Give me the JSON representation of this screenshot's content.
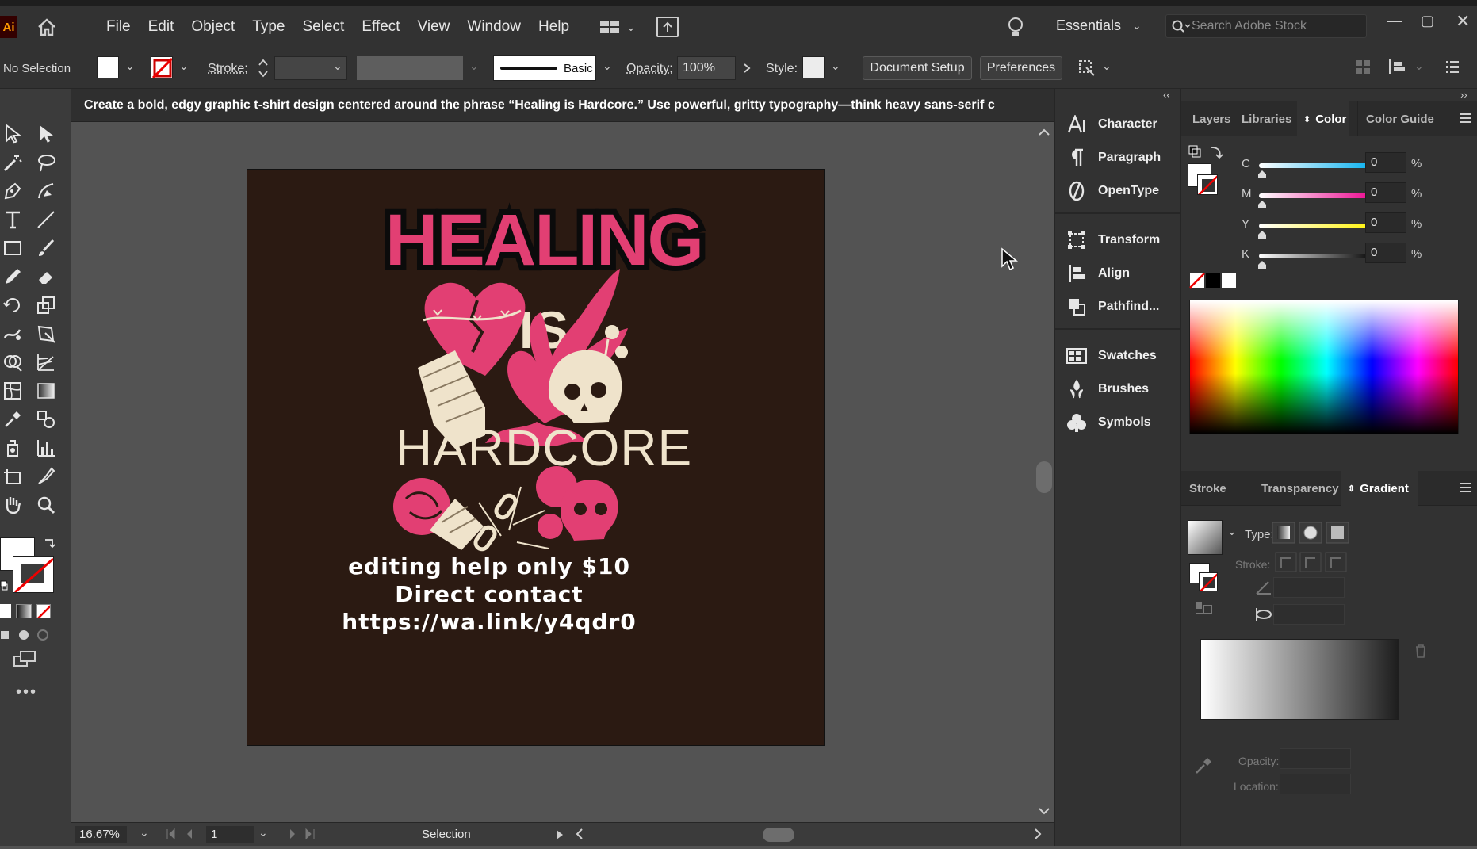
{
  "app": {
    "logo": "Ai"
  },
  "menu": [
    "File",
    "Edit",
    "Object",
    "Type",
    "Select",
    "Effect",
    "View",
    "Window",
    "Help"
  ],
  "workspace": {
    "label": "Essentials"
  },
  "search": {
    "placeholder": "Search Adobe Stock"
  },
  "control_bar": {
    "selection_state": "No Selection",
    "stroke_label": "Stroke:",
    "brush_label": "Basic",
    "opacity_label": "Opacity:",
    "opacity_value": "100%",
    "style_label": "Style:",
    "document_setup": "Document Setup",
    "preferences": "Preferences"
  },
  "prompt_text": "Create a bold, edgy graphic t-shirt design centered around the phrase “Healing is Hardcore.” Use powerful, gritty typography—think heavy sans-serif c",
  "artwork": {
    "title_line1": "HEALING",
    "title_line2": "IS",
    "title_line3": "HARDCORE",
    "footer_line1": "editing help only $10",
    "footer_line2": "Direct contact",
    "footer_line3": "https://wa.link/y4qdr0",
    "colors": {
      "background": "#2b1a12",
      "pink": "#e23f73",
      "cream": "#efe3cb"
    }
  },
  "status_bar": {
    "zoom": "16.67%",
    "artboard_number": "1",
    "tool": "Selection"
  },
  "mid_panel": {
    "items": [
      "Character",
      "Paragraph",
      "OpenType",
      "Transform",
      "Align",
      "Pathfind...",
      "Swatches",
      "Brushes",
      "Symbols"
    ]
  },
  "color_panel": {
    "tabs": [
      "Layers",
      "Libraries",
      "Color",
      "Color Guide"
    ],
    "active_tab": "Color",
    "channels": [
      {
        "label": "C",
        "value": "0",
        "unit": "%"
      },
      {
        "label": "M",
        "value": "0",
        "unit": "%"
      },
      {
        "label": "Y",
        "value": "0",
        "unit": "%"
      },
      {
        "label": "K",
        "value": "0",
        "unit": "%"
      }
    ]
  },
  "gradient_panel": {
    "tabs": [
      "Stroke",
      "Transparency",
      "Gradient"
    ],
    "active_tab": "Gradient",
    "type_label": "Type:",
    "stroke_label": "Stroke:",
    "opacity_label": "Opacity:",
    "location_label": "Location:"
  }
}
